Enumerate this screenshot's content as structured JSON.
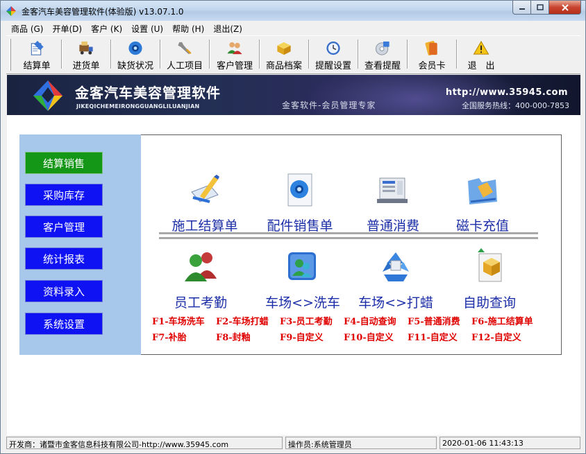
{
  "window": {
    "title": "金客汽车美容管理软件(体验版) v13.07.1.0",
    "minimize": "0",
    "maximize": "1",
    "close": "r"
  },
  "menu": [
    {
      "label": "商品 (G)"
    },
    {
      "label": "开单(D)"
    },
    {
      "label": "客户 (K)"
    },
    {
      "label": "设置 (U)"
    },
    {
      "label": "帮助 (H)"
    },
    {
      "label": "退出(Z)"
    }
  ],
  "toolbar": [
    {
      "label": "结算单",
      "icon": "checkout-icon"
    },
    {
      "label": "进货单",
      "icon": "truck-icon"
    },
    {
      "label": "缺货状况",
      "icon": "gear-globe-icon"
    },
    {
      "label": "人工项目",
      "icon": "wrench-icon"
    },
    {
      "label": "客户管理",
      "icon": "people-icon"
    },
    {
      "label": "商品档案",
      "icon": "box-icon"
    },
    {
      "label": "提醒设置",
      "icon": "clock-icon"
    },
    {
      "label": "查看提醒",
      "icon": "disc-icon"
    },
    {
      "label": "会员卡",
      "icon": "card-icon"
    },
    {
      "label": "退　出",
      "icon": "warning-icon"
    }
  ],
  "banner": {
    "title": "金客汽车美容管理软件",
    "subtitle": "JIKEQICHEMEIRONGGUANGLILUANJIAN",
    "slogan": "金客软件-会员管理专家",
    "url": "http://www.35945.com",
    "hotline": "全国服务热线：400-000-7853"
  },
  "sidebar": [
    {
      "label": "结算销售",
      "active": true
    },
    {
      "label": "采购库存",
      "active": false
    },
    {
      "label": "客户管理",
      "active": false
    },
    {
      "label": "统计报表",
      "active": false
    },
    {
      "label": "资料录入",
      "active": false
    },
    {
      "label": "系统设置",
      "active": false
    }
  ],
  "functions_row1": [
    {
      "label": "施工结算单",
      "icon": "pen-document-icon"
    },
    {
      "label": "配件销售单",
      "icon": "gear-document-icon"
    },
    {
      "label": "普通消费",
      "icon": "cash-register-icon"
    },
    {
      "label": "磁卡充值",
      "icon": "folder-card-icon"
    }
  ],
  "functions_row2": [
    {
      "label": "员工考勤",
      "icon": "employees-icon"
    },
    {
      "label": "车场<>洗车",
      "icon": "wash-icon"
    },
    {
      "label": "车场<>打蜡",
      "icon": "recycle-icon"
    },
    {
      "label": "自助查询",
      "icon": "package-doc-icon"
    }
  ],
  "hotkeys_row1": [
    "F1-车场洗车",
    "F2-车场打蜡",
    "F3-员工考勤",
    "F4-自动查询",
    "F5-普通消费",
    "F6-施工结算单"
  ],
  "hotkeys_row2": [
    "F7-补胎",
    "F8-封釉",
    "F9-自定义",
    "F10-自定义",
    "F11-自定义",
    "F12-自定义"
  ],
  "status": {
    "developer": "开发商：诸暨市金客信息科技有限公司-http://www.35945.com",
    "operator": "操作员:系统管理员",
    "datetime": "2020-01-06 11:43:13"
  },
  "colors": {
    "sidebar_bg": "#a7c8ea",
    "nav_button": "#0f13f4",
    "nav_active": "#149616",
    "function_label": "#1c2fa8",
    "hotkey": "#e00000"
  }
}
